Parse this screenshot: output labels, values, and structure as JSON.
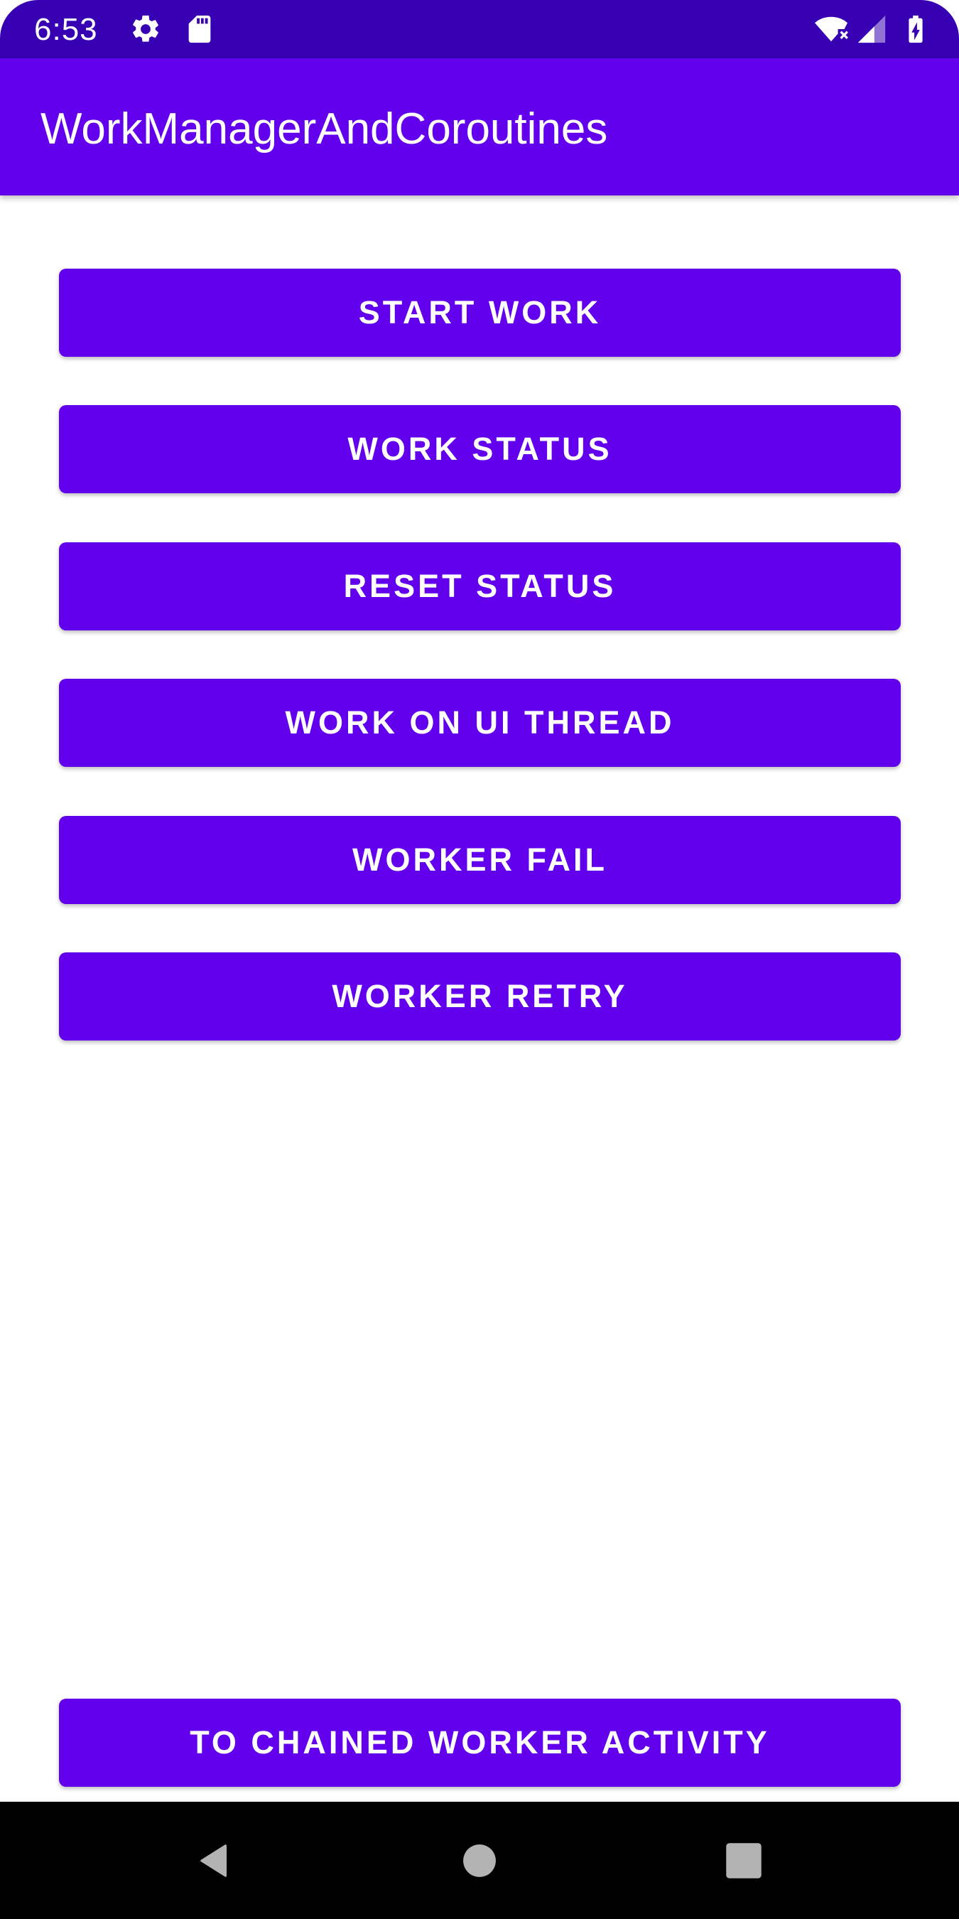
{
  "status_bar": {
    "time": "6:53",
    "icons": [
      "settings-gear-icon",
      "sd-card-icon",
      "wifi-icon",
      "cell-signal-icon",
      "battery-charging-icon"
    ],
    "background_color": "#3700b3"
  },
  "app_bar": {
    "title": "WorkManagerAndCoroutines",
    "background_color": "#6200ee"
  },
  "buttons": {
    "start_work": "START WORK",
    "work_status": "WORK STATUS",
    "reset_status": "RESET STATUS",
    "work_on_ui_thread": "WORK ON UI THREAD",
    "worker_fail": "WORKER FAIL",
    "worker_retry": "WORKER RETRY",
    "to_chained_worker_activity": "TO CHAINED WORKER ACTIVITY"
  },
  "button_color": "#6200ee",
  "nav_bar": {
    "icons": [
      "back-icon",
      "home-icon",
      "recents-icon"
    ]
  }
}
